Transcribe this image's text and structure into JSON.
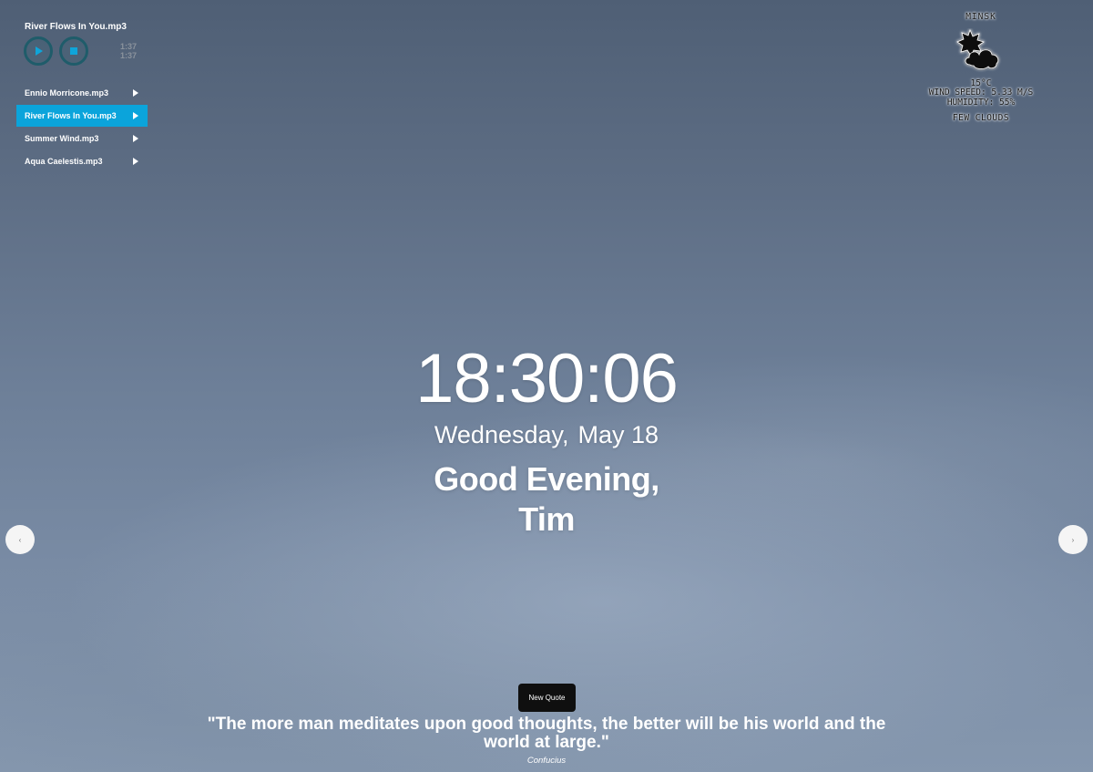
{
  "player": {
    "current_track": "River Flows In You.mp3",
    "time_current": "1:37",
    "time_total": "1:37",
    "playlist": [
      {
        "title": "Ennio Morricone.mp3"
      },
      {
        "title": "River Flows In You.mp3",
        "active": true
      },
      {
        "title": "Summer Wind.mp3"
      },
      {
        "title": "Aqua Caelestis.mp3"
      }
    ],
    "accent_color": "#0ba4db"
  },
  "weather": {
    "city": "MINSK",
    "icon": "few-clouds-icon",
    "temperature": "15°C",
    "wind": "WIND SPEED: 5.33 M/S",
    "humidity": "HUMIDITY: 55%",
    "description": "FEW CLOUDS"
  },
  "clock": {
    "time": "18:30:06",
    "weekday": "Wednesday,",
    "date": "May 18"
  },
  "greeting": {
    "line1": "Good Evening,",
    "name": "Tim"
  },
  "slider": {
    "prev_label": "‹",
    "next_label": "›"
  },
  "quote": {
    "button_label": "New Quote",
    "text": "\"The more man meditates upon good thoughts, the better will be his world and the world at large.\"",
    "author": "Confucius"
  }
}
